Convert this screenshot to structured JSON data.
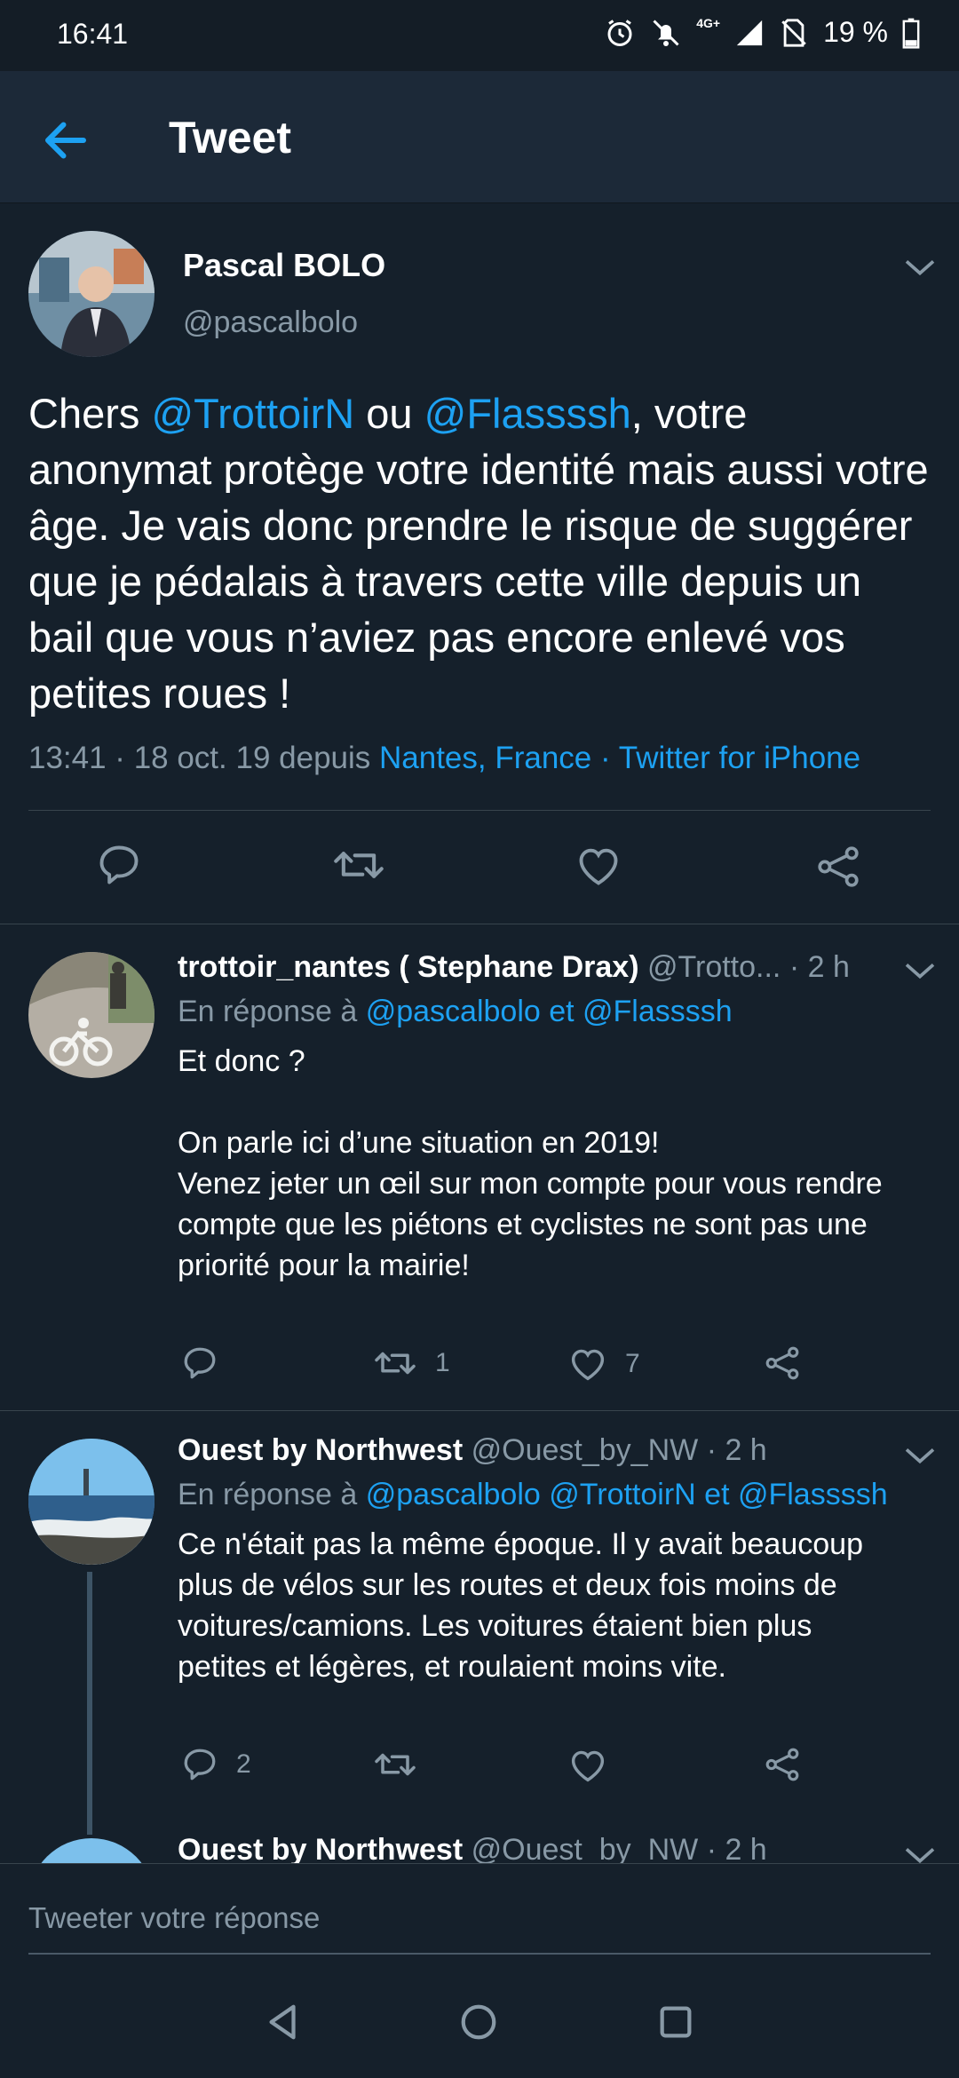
{
  "status_bar": {
    "time": "16:41",
    "network": "4G+",
    "battery": "19 %"
  },
  "header": {
    "title": "Tweet"
  },
  "main_tweet": {
    "author_name": "Pascal BOLO",
    "handle": "@pascalbolo",
    "text_parts": [
      "Chers ",
      "@TrottoirN",
      " ou ",
      "@Flassssh",
      ", votre anonymat protège votre identité mais aussi votre âge. Je vais donc prendre le risque de suggérer que je pédalais à travers cette ville depuis un bail que vous n’aviez pas encore enlevé vos petites roues !"
    ],
    "meta_time": "13:41 · 18 oct. 19 depuis ",
    "meta_location": "Nantes, France",
    "meta_sep": " · ",
    "meta_source": "Twitter for iPhone"
  },
  "replies": [
    {
      "name": "trottoir_nantes ( Stephane Drax)",
      "handle": "@Trotto...",
      "time": "· 2 h",
      "reply_prefix": "En réponse à ",
      "reply_targets": "@pascalbolo et @Flassssh",
      "lines": [
        "Et donc ?",
        "",
        "On parle ici d’une situation en 2019!",
        "Venez jeter un œil sur mon compte pour vous rendre",
        "compte que les piétons et cyclistes ne sont pas une",
        "priorité pour la mairie!"
      ],
      "counts": {
        "reply": "",
        "retweet": "1",
        "like": "7"
      }
    },
    {
      "name": "Ouest by Northwest",
      "handle": "@Ouest_by_NW",
      "time": "· 2 h",
      "reply_prefix": "En réponse à ",
      "reply_targets": "@pascalbolo @TrottoirN et @Flassssh",
      "lines": [
        "Ce n'était pas la même époque. Il y avait beaucoup",
        "plus de vélos sur les routes et deux fois moins de",
        "voitures/camions. Les voitures étaient bien plus",
        "petites et légères, et roulaient moins vite."
      ],
      "counts": {
        "reply": "2",
        "retweet": "",
        "like": ""
      }
    },
    {
      "name": "Ouest by Northwest",
      "handle": "@Ouest_by_NW",
      "time": "· 2 h"
    }
  ],
  "composer": {
    "placeholder": "Tweeter votre réponse"
  },
  "colors": {
    "background": "#15202b",
    "accent": "#1da1f2",
    "muted": "#8899a6"
  }
}
